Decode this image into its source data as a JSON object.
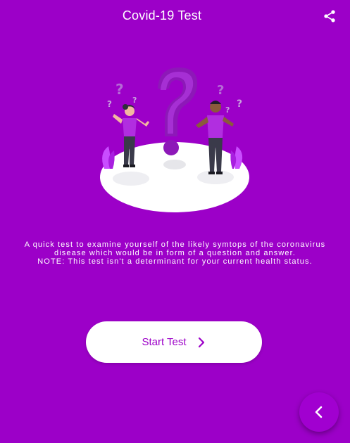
{
  "app": {
    "title": "Covid-19 Test"
  },
  "header": {
    "share_icon": "share-icon"
  },
  "hero": {
    "image_name": "covid-question-illustration"
  },
  "description": {
    "line1": "A quick test to examine yourself of the likely symtops of the  coronavirus",
    "line2": "disease which would be in form of a question and answer.",
    "line3": "NOTE: This test isn't a determinant for your current health status."
  },
  "actions": {
    "start_label": "Start Test",
    "start_icon": "chevron-right-icon",
    "fab_icon": "chevron-left-icon"
  },
  "colors": {
    "background": "#9c00c8",
    "accent": "#9c00c8",
    "button_bg": "#ffffff",
    "text": "#ffffff"
  }
}
